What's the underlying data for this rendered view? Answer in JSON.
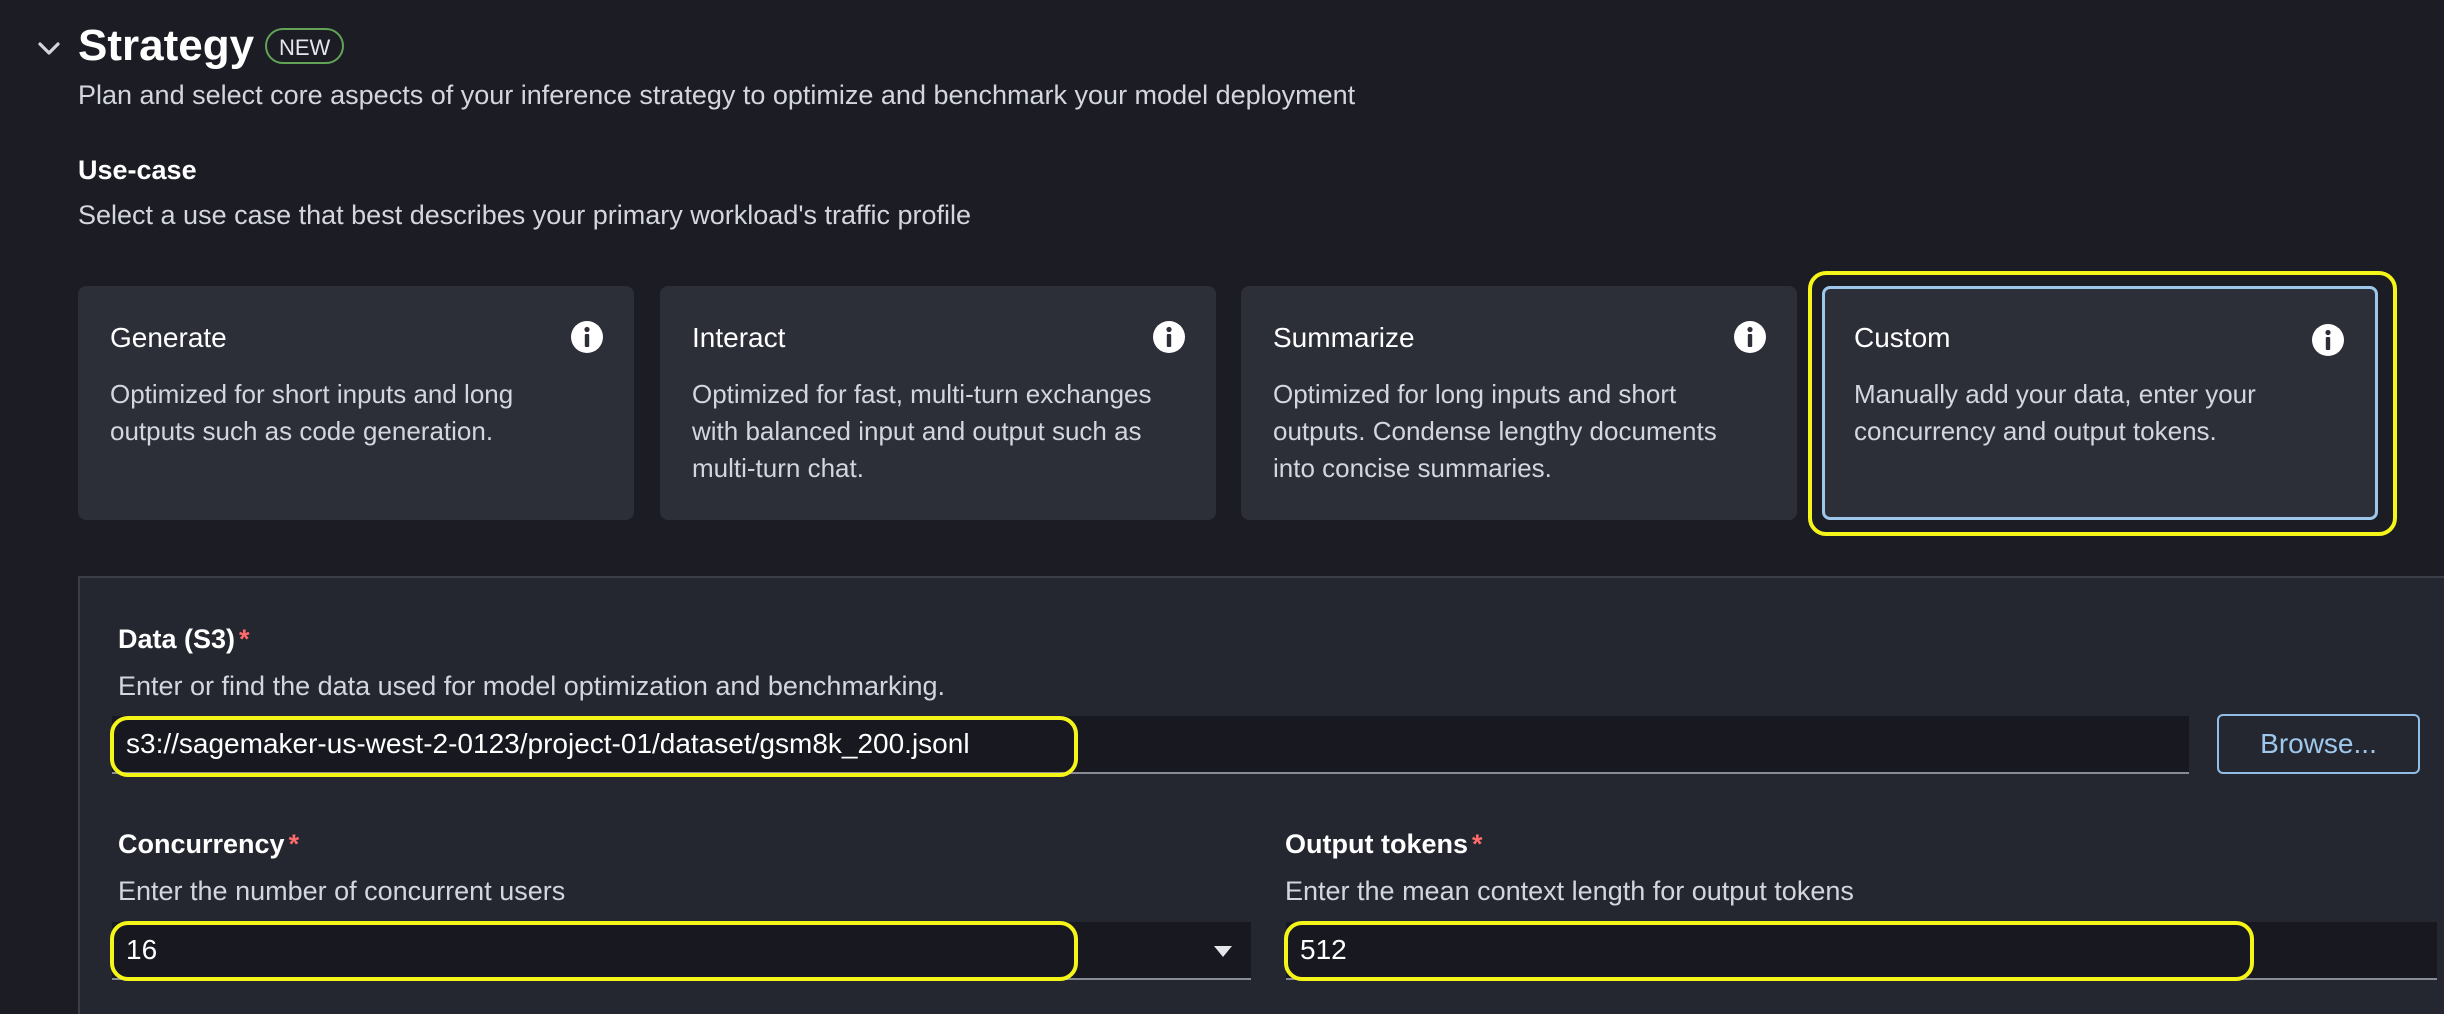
{
  "header": {
    "title": "Strategy",
    "badge": "NEW",
    "subtitle": "Plan and select core aspects of your inference strategy to optimize and benchmark your model deployment"
  },
  "use_case": {
    "heading": "Use-case",
    "description": "Select a use case that best describes your primary workload's traffic profile",
    "cards": [
      {
        "title": "Generate",
        "description": "Optimized for short inputs and long outputs such as code generation.",
        "selected": false
      },
      {
        "title": "Interact",
        "description": "Optimized for fast, multi-turn exchanges with balanced input and output such as multi-turn chat.",
        "selected": false
      },
      {
        "title": "Summarize",
        "description": "Optimized for long inputs and short outputs. Condense lengthy documents into concise summaries.",
        "selected": false
      },
      {
        "title": "Custom",
        "description": "Manually add your data, enter your concurrency and output tokens.",
        "selected": true
      }
    ]
  },
  "data_field": {
    "label": "Data (S3)",
    "required_marker": "*",
    "description": "Enter or find the data used for model optimization and benchmarking.",
    "value": "s3://sagemaker-us-west-2-0123/project-01/dataset/gsm8k_200.jsonl",
    "browse_label": "Browse..."
  },
  "concurrency_field": {
    "label": "Concurrency",
    "required_marker": "*",
    "description": "Enter the number of concurrent users",
    "value": "16"
  },
  "output_tokens_field": {
    "label": "Output tokens",
    "required_marker": "*",
    "description": "Enter the mean context length for output tokens",
    "value": "512"
  },
  "colors": {
    "background": "#1b1c24",
    "card": "#2c2e38",
    "selected_border": "#9dc7eb",
    "highlight": "#f5f51a",
    "required": "#ff6b6b",
    "badge_border": "#63a356"
  },
  "icons": {
    "collapse": "chevron-down-icon",
    "info": "info-icon",
    "dropdown": "caret-down-icon"
  }
}
